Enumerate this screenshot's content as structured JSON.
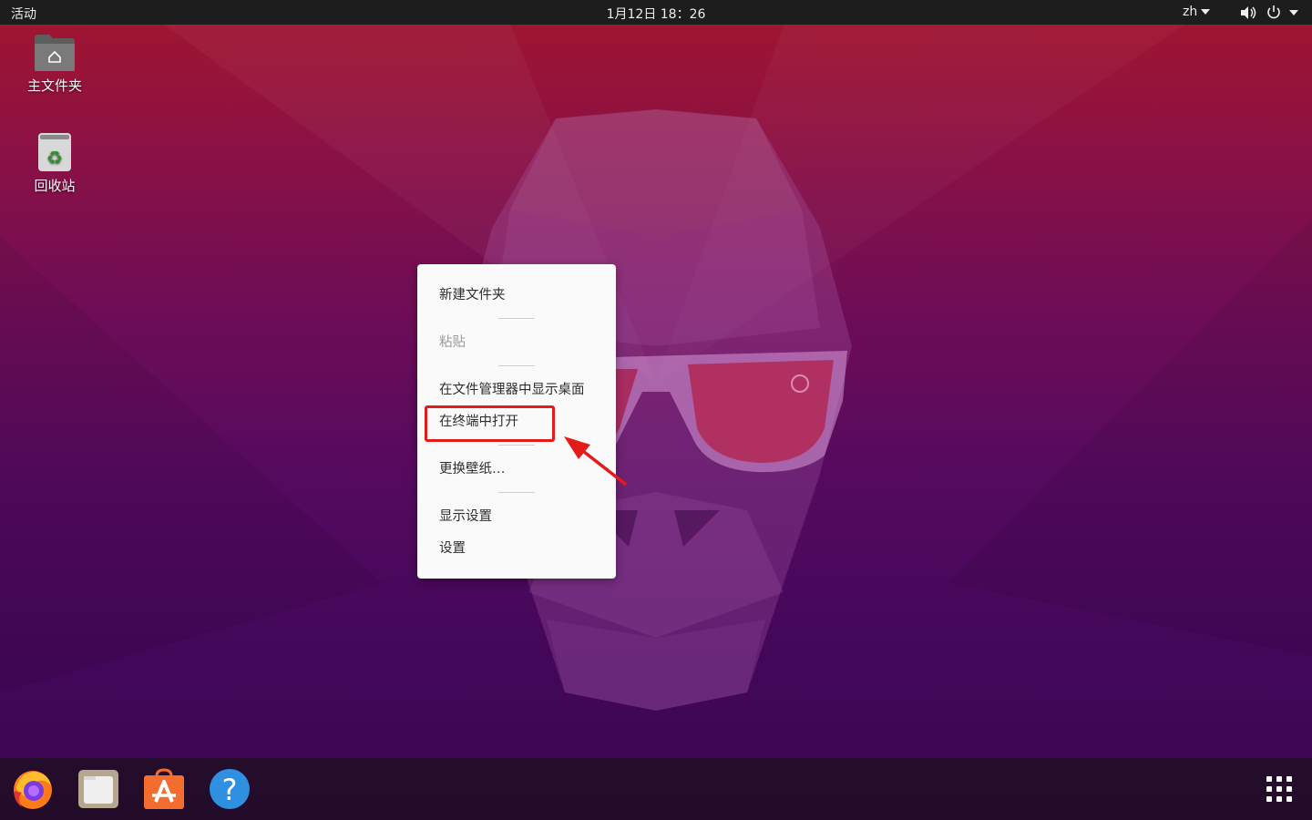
{
  "topbar": {
    "activities": "活动",
    "clock": "1月12日 18：26",
    "input_method": "zh"
  },
  "desktop_icons": [
    {
      "label": "主文件夹",
      "icon": "home-folder-icon"
    },
    {
      "label": "回收站",
      "icon": "trash-icon"
    }
  ],
  "context_menu": {
    "items": [
      {
        "label": "新建文件夹",
        "enabled": true
      },
      {
        "label": "粘贴",
        "enabled": false
      },
      {
        "label": "在文件管理器中显示桌面",
        "enabled": true
      },
      {
        "label": "在终端中打开",
        "enabled": true,
        "highlighted": true
      },
      {
        "label": "更换壁纸…",
        "enabled": true
      },
      {
        "label": "显示设置",
        "enabled": true
      },
      {
        "label": "设置",
        "enabled": true
      }
    ]
  },
  "dock": {
    "apps": [
      {
        "name": "firefox-icon"
      },
      {
        "name": "files-icon"
      },
      {
        "name": "software-center-icon"
      },
      {
        "name": "help-icon"
      }
    ],
    "show_apps": "app-grid-icon"
  },
  "colors": {
    "annotation": "#e31b1b",
    "topbar": "#1d1d1d",
    "menu_bg": "#fafafa"
  }
}
